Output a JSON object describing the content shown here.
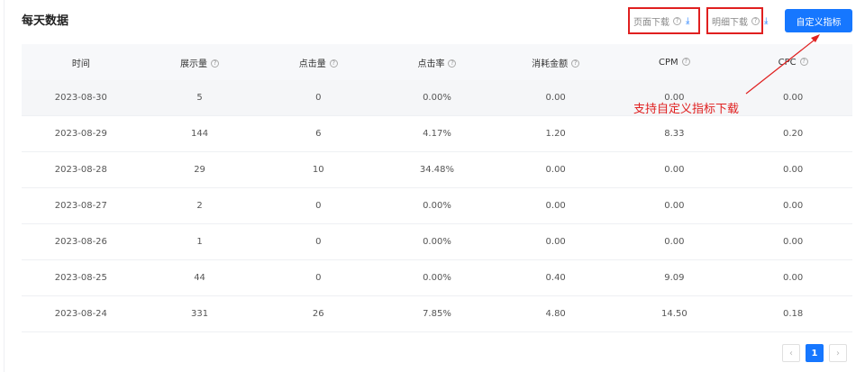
{
  "title": "每天数据",
  "toolbar": {
    "page_download": "页面下载",
    "detail_download": "明细下载",
    "custom_metrics": "自定义指标"
  },
  "table": {
    "headers": [
      "时间",
      "展示量",
      "点击量",
      "点击率",
      "消耗金额",
      "CPM",
      "CPC"
    ],
    "rows": [
      [
        "2023-08-30",
        "5",
        "0",
        "0.00%",
        "0.00",
        "0.00",
        "0.00"
      ],
      [
        "2023-08-29",
        "144",
        "6",
        "4.17%",
        "1.20",
        "8.33",
        "0.20"
      ],
      [
        "2023-08-28",
        "29",
        "10",
        "34.48%",
        "0.00",
        "0.00",
        "0.00"
      ],
      [
        "2023-08-27",
        "2",
        "0",
        "0.00%",
        "0.00",
        "0.00",
        "0.00"
      ],
      [
        "2023-08-26",
        "1",
        "0",
        "0.00%",
        "0.00",
        "0.00",
        "0.00"
      ],
      [
        "2023-08-25",
        "44",
        "0",
        "0.00%",
        "0.40",
        "9.09",
        "0.00"
      ],
      [
        "2023-08-24",
        "331",
        "26",
        "7.85%",
        "4.80",
        "14.50",
        "0.18"
      ]
    ]
  },
  "annotation": "支持自定义指标下载",
  "pagination": {
    "current": "1",
    "prev": "‹",
    "next": "›"
  },
  "colors": {
    "accent": "#1677ff",
    "annotation": "#e02020"
  }
}
